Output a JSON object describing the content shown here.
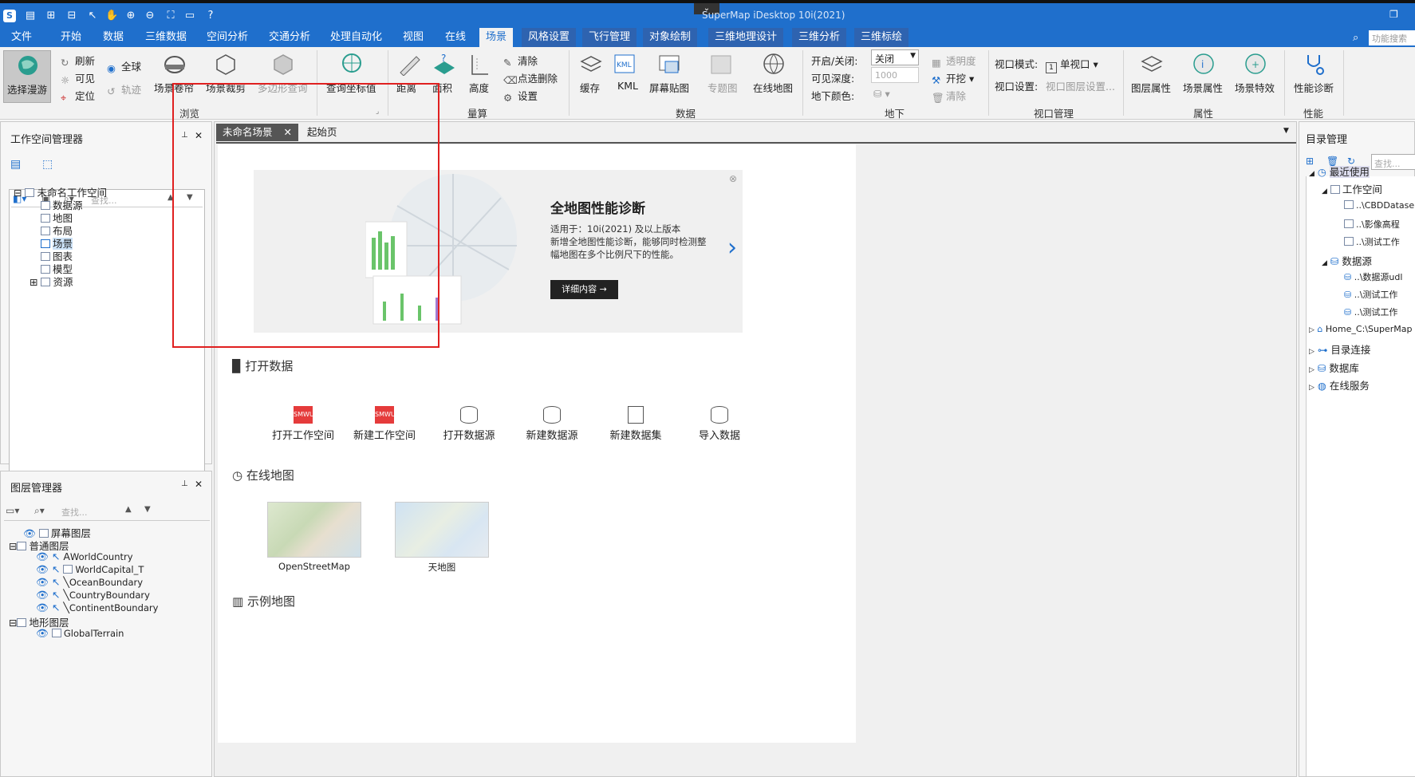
{
  "window": {
    "title": "SuperMap iDesktop 10i(2021)"
  },
  "search": {
    "placeholder": "功能搜索"
  },
  "menu": [
    {
      "label": "文件"
    },
    {
      "label": "开始"
    },
    {
      "label": "数据"
    },
    {
      "label": "三维数据"
    },
    {
      "label": "空间分析"
    },
    {
      "label": "交通分析"
    },
    {
      "label": "处理自动化"
    },
    {
      "label": "视图"
    },
    {
      "label": "在线"
    },
    {
      "label": "场景"
    },
    {
      "label": "风格设置"
    },
    {
      "label": "飞行管理"
    },
    {
      "label": "对象绘制"
    },
    {
      "label": "三维地理设计"
    },
    {
      "label": "三维分析"
    },
    {
      "label": "三维标绘"
    }
  ],
  "ribbon": {
    "select_roam": "选择漫游",
    "refresh": "刷新",
    "visible": "可见",
    "locate": "定位",
    "globe": "全球",
    "track": "轨迹",
    "scene_shutter": "场景卷帘",
    "scene_clip": "场景裁剪",
    "polygon_query": "多边形查询",
    "query_coord": "查询坐标值",
    "browse_group": "浏览",
    "distance": "距离",
    "area": "面积",
    "height": "高度",
    "clear": "清除",
    "point_delete": "点选删除",
    "settings": "设置",
    "measure_group": "量算",
    "cache": "缓存",
    "kml": "KML",
    "screen_map": "屏幕贴图",
    "theme_map": "专题图",
    "online_map": "在线地图",
    "data_group": "数据",
    "toggle_label": "开启/关闭:",
    "toggle_value": "关闭",
    "depth_label": "可见深度:",
    "depth_value": "1000",
    "under_color_label": "地下颜色:",
    "transparency": "透明度",
    "excavate": "开挖",
    "under_clear": "清除",
    "underground_group": "地下",
    "view_mode_label": "视口模式:",
    "view_mode_value": "单视口",
    "view_settings_label": "视口设置:",
    "view_settings_value": "视口图层设置...",
    "viewport_group": "视口管理",
    "layer_props": "图层属性",
    "scene_props": "场景属性",
    "scene_effects": "场景特效",
    "props_group": "属性",
    "perf_diag": "性能诊断",
    "perf_group": "性能"
  },
  "workspace": {
    "title": "工作空间管理器",
    "search_placeholder": "查找...",
    "root": "未命名工作空间",
    "items": [
      "数据源",
      "地图",
      "布局",
      "场景",
      "图表",
      "模型",
      "资源"
    ]
  },
  "layers": {
    "title": "图层管理器",
    "search_placeholder": "查找...",
    "screen": "屏幕图层",
    "normal": "普通图层",
    "normal_items": [
      "WorldCountry",
      "WorldCapital_T",
      "OceanBoundary",
      "CountryBoundary",
      "ContinentBoundary"
    ],
    "terrain": "地形图层",
    "terrain_items": [
      "GlobalTerrain"
    ]
  },
  "tabs": {
    "scene": "未命名场景",
    "start": "起始页"
  },
  "banner": {
    "title": "全地图性能诊断",
    "line1": "适用于：10i(2021) 及以上版本",
    "line2": "新增全地图性能诊断，能够同时检测整",
    "line3": "幅地图在多个比例尺下的性能。",
    "button": "详细内容 →"
  },
  "open_data": {
    "title": "打开数据",
    "items": [
      "打开工作空间",
      "新建工作空间",
      "打开数据源",
      "新建数据源",
      "新建数据集",
      "导入数据"
    ]
  },
  "online_maps": {
    "title": "在线地图",
    "items": [
      "OpenStreetMap",
      "天地图"
    ]
  },
  "example_maps": {
    "title": "示例地图"
  },
  "catalog": {
    "title": "目录管理",
    "search_placeholder": "查找...",
    "recent": "最近使用",
    "workspace": "工作空间",
    "ws_items": [
      "..\\CBDDatase",
      "..\\影像高程",
      "..\\测试工作"
    ],
    "datasource": "数据源",
    "ds_items": [
      "..\\数据源udl",
      "..\\测试工作",
      "..\\测试工作"
    ],
    "home": "Home_C:\\SuperMap",
    "dir_conn": "目录连接",
    "database": "数据库",
    "online_service": "在线服务"
  },
  "colors": {
    "brand": "#1f6fcc",
    "highlight_box": "#e02020"
  }
}
